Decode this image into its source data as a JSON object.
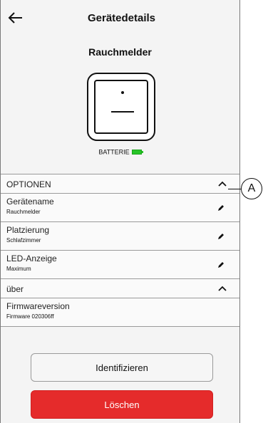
{
  "header": {
    "title": "Gerätedetails"
  },
  "device": {
    "name": "Rauchmelder",
    "battery_label": "BATTERIE"
  },
  "options": {
    "section_label": "OPTIONEN",
    "items": [
      {
        "title": "Gerätename",
        "value": "Rauchmelder"
      },
      {
        "title": "Platzierung",
        "value": "Schlafzimmer"
      },
      {
        "title": "LED-Anzeige",
        "value": "Maximum"
      }
    ]
  },
  "about": {
    "section_label": "über",
    "items": [
      {
        "title": "Firmwareversion",
        "value": "Firmware 020306ff"
      }
    ]
  },
  "buttons": {
    "identify": "Identifizieren",
    "delete": "Löschen"
  },
  "callout": {
    "label": "A"
  },
  "colors": {
    "delete": "#e52b2b",
    "battery": "#28c428"
  },
  "icons": {
    "back": "arrow-left-icon",
    "collapse": "chevron-up-icon",
    "edit": "pencil-icon"
  }
}
